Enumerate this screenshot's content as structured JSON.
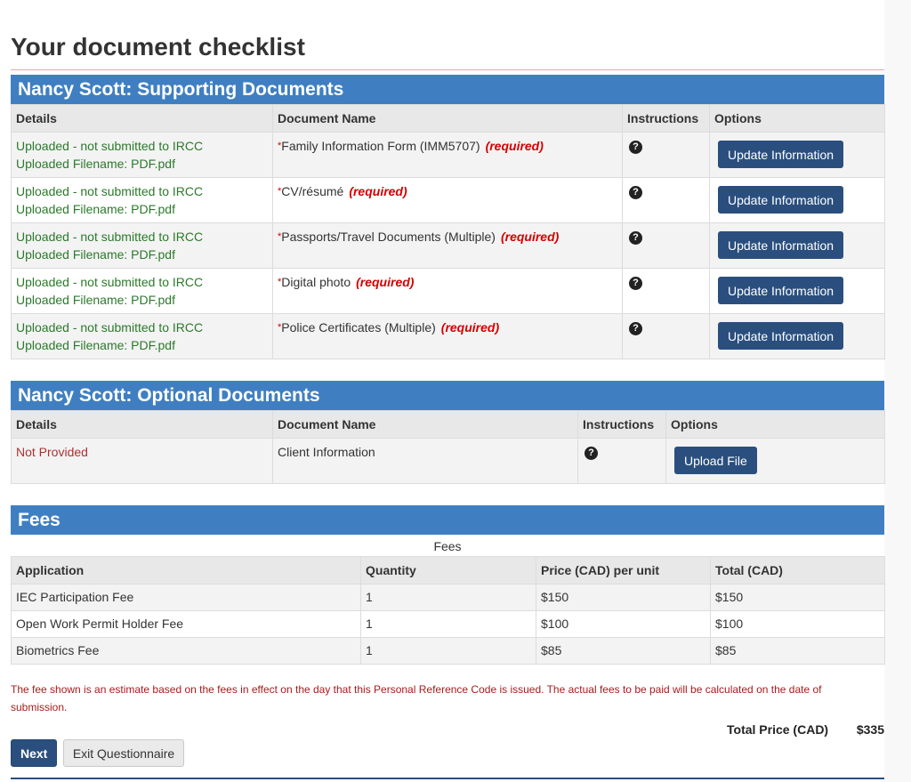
{
  "page_title": "Your document checklist",
  "supporting": {
    "heading": "Nancy Scott: Supporting Documents",
    "headers": {
      "details": "Details",
      "doc_name": "Document Name",
      "instructions": "Instructions",
      "options": "Options"
    },
    "rows": [
      {
        "status": "Uploaded - not submitted to IRCC",
        "filename": "Uploaded Filename:  PDF.pdf",
        "star": "*",
        "name": "Family Information Form (IMM5707)",
        "req": "(required)",
        "button": "Update Information"
      },
      {
        "status": "Uploaded - not submitted to IRCC",
        "filename": "Uploaded Filename:  PDF.pdf",
        "star": "*",
        "name": "CV/résumé",
        "req": "(required)",
        "button": "Update Information"
      },
      {
        "status": "Uploaded - not submitted to IRCC",
        "filename": "Uploaded Filename:  PDF.pdf",
        "star": "*",
        "name": "Passports/Travel Documents (Multiple)",
        "req": "(required)",
        "button": "Update Information"
      },
      {
        "status": "Uploaded - not submitted to IRCC",
        "filename": "Uploaded Filename:  PDF.pdf",
        "star": "*",
        "name": "Digital photo",
        "req": "(required)",
        "button": "Update Information"
      },
      {
        "status": "Uploaded - not submitted to IRCC",
        "filename": "Uploaded Filename:  PDF.pdf",
        "star": "*",
        "name": "Police Certificates (Multiple)",
        "req": "(required)",
        "button": "Update Information"
      }
    ]
  },
  "optional": {
    "heading": "Nancy Scott: Optional Documents",
    "headers": {
      "details": "Details",
      "doc_name": "Document Name",
      "instructions": "Instructions",
      "options": "Options"
    },
    "rows": [
      {
        "status": "Not Provided",
        "name": "Client Information",
        "button": "Upload File"
      }
    ]
  },
  "fees": {
    "heading": "Fees",
    "caption": "Fees",
    "headers": {
      "application": "Application",
      "quantity": "Quantity",
      "price": "Price (CAD) per unit",
      "total": "Total (CAD)"
    },
    "rows": [
      {
        "application": "IEC Participation Fee",
        "quantity": "1",
        "price": "$150",
        "total": "$150"
      },
      {
        "application": "Open Work Permit Holder Fee",
        "quantity": "1",
        "price": "$100",
        "total": "$100"
      },
      {
        "application": "Biometrics Fee",
        "quantity": "1",
        "price": "$85",
        "total": "$85"
      }
    ],
    "disclaimer": "The fee shown is an estimate based on the fees in effect on the day that this Personal Reference Code is issued. The actual fees to be paid will be calculated on the date of submission.",
    "total_label": "Total Price (CAD)",
    "total_value": "$335"
  },
  "help_icon_glyph": "?",
  "icons": {
    "help": "question-circle-icon"
  },
  "buttons": {
    "next": "Next",
    "exit": "Exit Questionnaire"
  },
  "colors": {
    "section_header": "#3f7fc1",
    "button": "#2a4f7e",
    "uploaded_status": "#2b7a2b",
    "required": "#d40000",
    "not_provided": "#b03030"
  }
}
